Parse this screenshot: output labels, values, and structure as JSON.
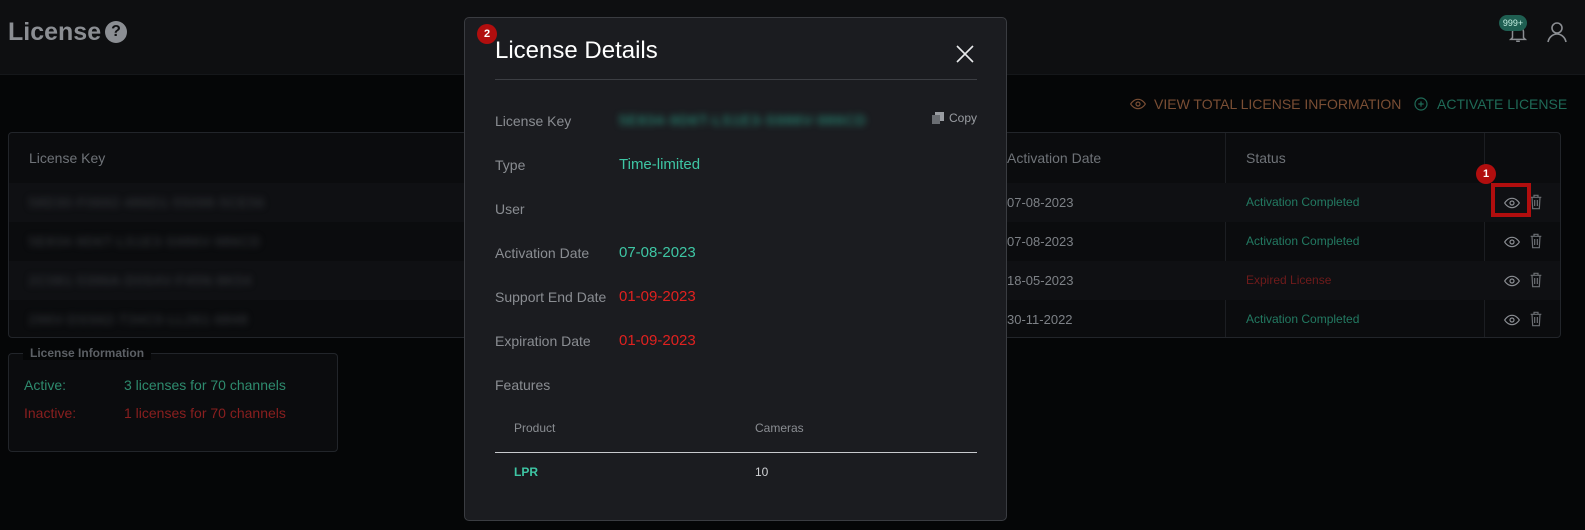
{
  "header": {
    "title": "License",
    "help_icon": "?",
    "notification_badge": "999+"
  },
  "actions": {
    "view_total": "VIEW TOTAL LICENSE INFORMATION",
    "activate": "ACTIVATE LICENSE"
  },
  "table": {
    "columns": {
      "license_key": "License Key",
      "activation_date": "Activation Date",
      "status": "Status"
    },
    "rows": [
      {
        "key": "58D30-F0692-486D1-55098-5CE56",
        "activation_date": "07-08-2023",
        "status": "Activation Completed",
        "status_color": "#237a62"
      },
      {
        "key": "5E834-9D6T-LS1E3-S986V-986CD",
        "activation_date": "07-08-2023",
        "status": "Activation Completed",
        "status_color": "#237a62"
      },
      {
        "key": "2C081-5396A-D0S4V-F45N-8K54",
        "activation_date": "18-05-2023",
        "status": "Expired License",
        "status_color": "#6f1b1b"
      },
      {
        "key": "296V-DSS62-T34C0-LL261-6848",
        "activation_date": "30-11-2022",
        "status": "Activation Completed",
        "status_color": "#237a62"
      }
    ]
  },
  "license_info": {
    "legend": "License Information",
    "active_label": "Active:",
    "active_value": "3 licenses for 70 channels",
    "inactive_label": "Inactive:",
    "inactive_value": "1 licenses for 70 channels"
  },
  "modal": {
    "title": "License Details",
    "copy_label": "Copy",
    "fields": {
      "license_key_label": "License Key",
      "license_key_value": "5E834-9D6T-LS1E3-S986V-986CD",
      "type_label": "Type",
      "type_value": "Time-limited",
      "user_label": "User",
      "user_value": "",
      "activation_label": "Activation Date",
      "activation_value": "07-08-2023",
      "support_end_label": "Support End Date",
      "support_end_value": "01-09-2023",
      "expiration_label": "Expiration Date",
      "expiration_value": "01-09-2023",
      "features_label": "Features"
    },
    "features": {
      "product_header": "Product",
      "cameras_header": "Cameras",
      "product": "LPR",
      "cameras": "10"
    }
  },
  "annotations": {
    "marker_1": "1",
    "marker_2": "2"
  },
  "colors": {
    "highlight": "#b10e0e",
    "teal": "#3ec6a4",
    "red_value": "#e0211f"
  }
}
